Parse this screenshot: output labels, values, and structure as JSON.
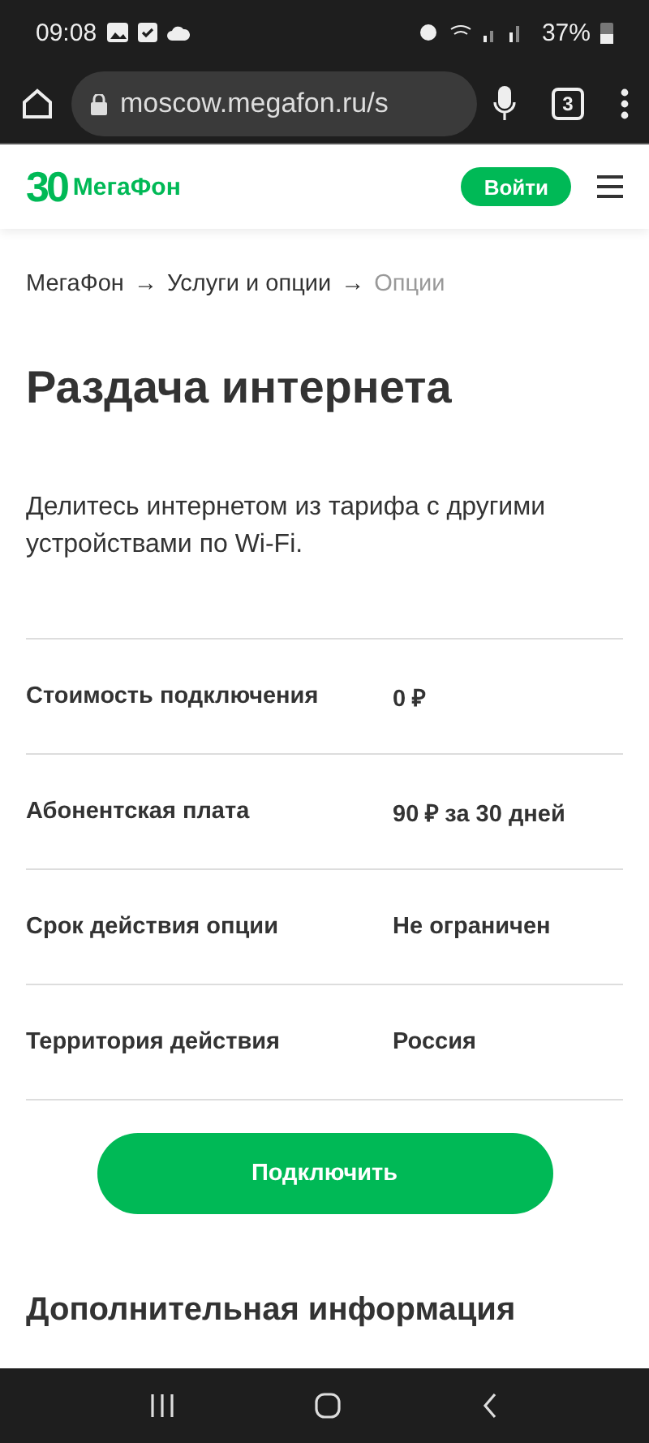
{
  "status_bar": {
    "time": "09:08",
    "battery": "37%"
  },
  "browser": {
    "url": "moscow.megafon.ru/s",
    "tab_count": "3"
  },
  "header": {
    "logo_number": "30",
    "logo_text": "МегаФон",
    "login_button": "Войти"
  },
  "breadcrumbs": [
    {
      "label": "МегаФон",
      "current": false
    },
    {
      "label": "Услуги и опции",
      "current": false
    },
    {
      "label": "Опции",
      "current": true
    }
  ],
  "breadcrumb_separator": "→",
  "title": "Раздача интернета",
  "description": "Делитесь интернетом из тарифа с другими устройствами по Wi-Fi.",
  "details": [
    {
      "label": "Стоимость подключения",
      "value": "0 ₽"
    },
    {
      "label": "Абонентская плата",
      "value": "90 ₽ за 30 дней"
    },
    {
      "label": "Срок действия опции",
      "value": "Не ограничен"
    },
    {
      "label": "Территория действия",
      "value": "Россия"
    }
  ],
  "connect_button": "Подключить",
  "section_title": "Дополнительная информация"
}
